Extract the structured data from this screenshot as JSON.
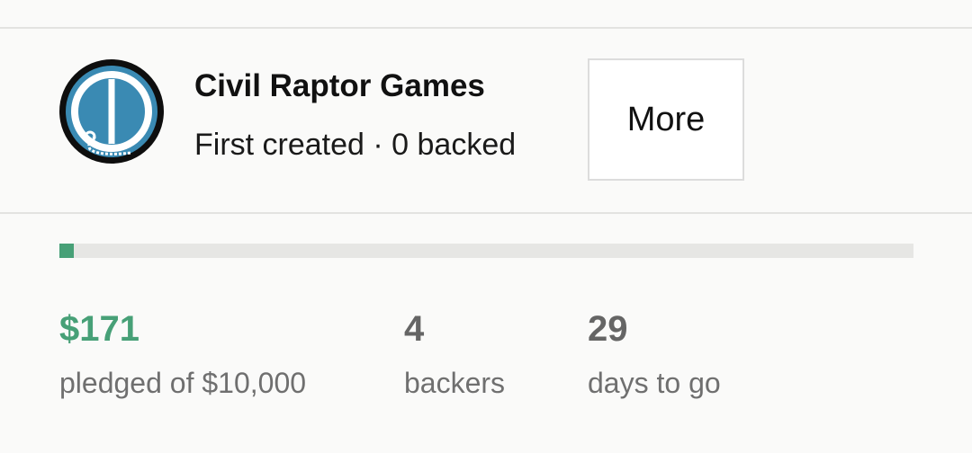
{
  "creator": {
    "name": "Civil Raptor Games",
    "meta": "First created · 0 backed",
    "more_label": "More"
  },
  "progress": {
    "fraction": 0.0171,
    "fill_color": "#47a077"
  },
  "stats": {
    "pledged_value": "$171",
    "pledged_label": "pledged of $10,000",
    "backers_value": "4",
    "backers_label": "backers",
    "days_value": "29",
    "days_label": "days to go"
  },
  "icons": {
    "avatar": "creator-logo-icon"
  },
  "colors": {
    "accent_green": "#47a077",
    "muted_text": "#6f6f6f",
    "avatar_blue": "#3a8ab3"
  }
}
